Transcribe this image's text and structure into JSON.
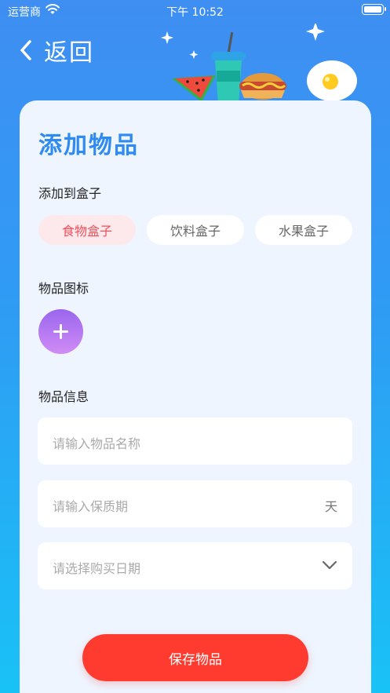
{
  "status_bar": {
    "carrier": "运营商",
    "time": "下午 10:52"
  },
  "nav": {
    "back_label": "返回"
  },
  "page": {
    "title": "添加物品"
  },
  "box_section": {
    "label": "添加到盒子",
    "chips": [
      {
        "label": "食物盒子",
        "selected": true
      },
      {
        "label": "饮料盒子",
        "selected": false
      },
      {
        "label": "水果盒子",
        "selected": false
      }
    ]
  },
  "icon_section": {
    "label": "物品图标"
  },
  "info_section": {
    "label": "物品信息",
    "name_placeholder": "请输入物品名称",
    "shelf_life_placeholder": "请输入保质期",
    "shelf_life_unit": "天",
    "purchase_date_placeholder": "请选择购买日期"
  },
  "actions": {
    "save_label": "保存物品"
  },
  "colors": {
    "accent": "#2f8bf0",
    "save": "#ff3b30",
    "chip_active_text": "#f0505a",
    "chip_active_bg": "#fde9ec"
  }
}
